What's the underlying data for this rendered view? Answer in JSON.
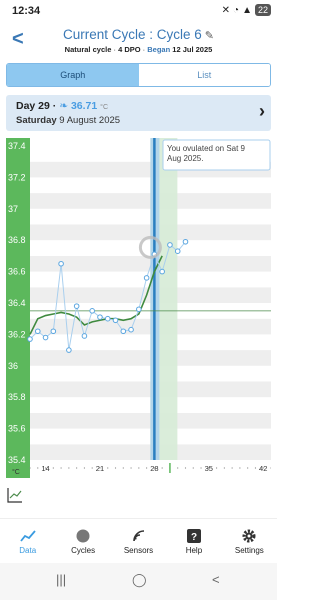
{
  "status": {
    "time": "12:34",
    "battery": "22"
  },
  "header": {
    "title_prefix": "Current Cycle : ",
    "title_cycle": "Cycle 6",
    "natural": "Natural cycle",
    "dpo": "4 DPO",
    "began_label": "Began",
    "began_date": "12 Jul 2025",
    "sep": "·"
  },
  "tabs": {
    "graph": "Graph",
    "list": "List"
  },
  "day": {
    "day_label": "Day 29",
    "dot": "·",
    "temp": "36.71",
    "unit": "°C",
    "weekday": "Saturday",
    "date": "9 August 2025"
  },
  "tooltip": {
    "text": "You ovulated on Sat 9 Aug 2025."
  },
  "colors": {
    "accent": "#3a9be0",
    "line": "#4a8a4a",
    "axis": "#5cb85c",
    "ovulation": "#2a7fc0"
  },
  "chart_data": {
    "type": "line",
    "y_ticks": [
      "37.4",
      "37.2",
      "37",
      "36.8",
      "36.6",
      "36.4",
      "36.2",
      "36",
      "35.8",
      "35.6",
      "35.4"
    ],
    "ylim": [
      35.4,
      37.4
    ],
    "xlim": [
      12,
      43
    ],
    "x_ticks": [
      "14",
      "21",
      "28",
      "35",
      "42"
    ],
    "x_unit": "°C",
    "coverline": 36.35,
    "ovulation_day": 28,
    "series": [
      {
        "x": [
          12,
          13,
          14,
          15,
          16,
          17,
          18,
          19,
          20,
          21,
          22,
          23,
          24,
          25,
          26,
          27,
          28,
          29,
          30,
          31,
          32
        ],
        "values": [
          36.17,
          36.22,
          36.18,
          36.22,
          36.65,
          36.1,
          36.38,
          36.19,
          36.35,
          36.31,
          36.3,
          36.29,
          36.22,
          36.23,
          36.36,
          36.56,
          36.71,
          36.6,
          36.77,
          36.73,
          36.79
        ]
      }
    ],
    "smoothed": [
      36.2,
      36.3,
      36.32,
      36.33,
      36.34,
      36.33,
      36.31,
      36.26,
      36.28,
      36.29,
      36.3,
      36.3,
      36.29,
      36.3,
      36.33,
      36.45,
      36.6,
      36.7
    ]
  },
  "nav": {
    "items": [
      {
        "label": "Data",
        "icon": "data-icon"
      },
      {
        "label": "Cycles",
        "icon": "cycles-icon"
      },
      {
        "label": "Sensors",
        "icon": "sensors-icon"
      },
      {
        "label": "Help",
        "icon": "help-icon"
      },
      {
        "label": "Settings",
        "icon": "settings-icon"
      }
    ]
  },
  "sysnav": {
    "recents": "|||",
    "home": "◯",
    "back": "<"
  }
}
